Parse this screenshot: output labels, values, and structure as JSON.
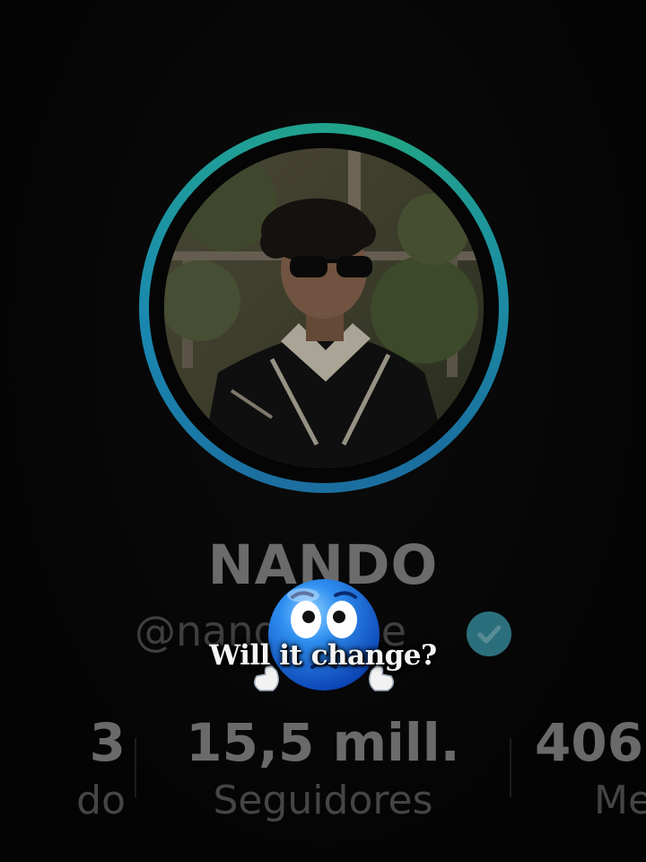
{
  "profile": {
    "display_name": "NANDO",
    "handle": "@nandoeeee",
    "verified": true
  },
  "stats": [
    {
      "value": "3",
      "label": "do"
    },
    {
      "value": "15,5 mill.",
      "label": "Seguidores"
    },
    {
      "value": "406",
      "label": "Me"
    }
  ],
  "overlay": {
    "caption": "Will it change?",
    "emoji": "worried-face-emoji"
  },
  "colors": {
    "ring_start": "#1c6fa0",
    "ring_end": "#22a585",
    "verified": "#2c6f7c"
  }
}
